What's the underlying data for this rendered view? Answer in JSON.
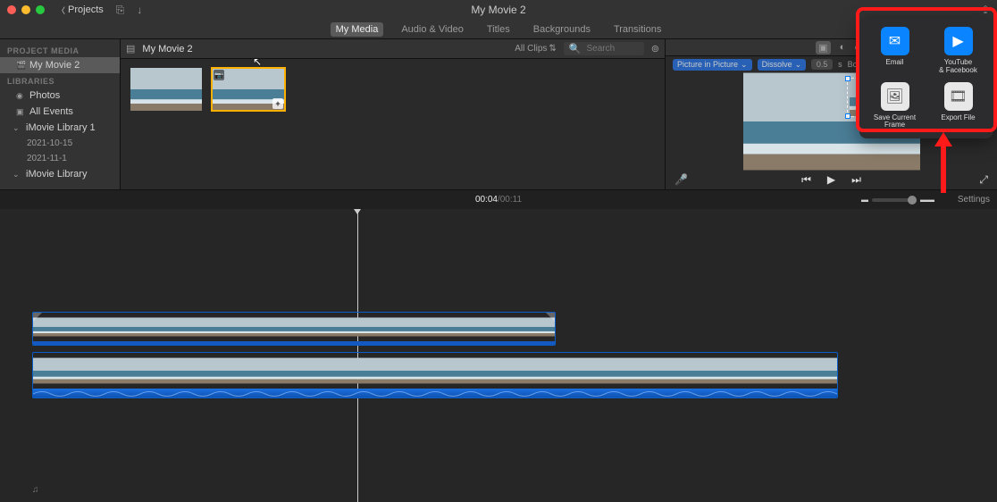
{
  "titlebar": {
    "back_label": "Projects",
    "title": "My Movie 2"
  },
  "tabs": [
    "My Media",
    "Audio & Video",
    "Titles",
    "Backgrounds",
    "Transitions"
  ],
  "tabs_selected": 0,
  "sidebar": {
    "section1": "PROJECT MEDIA",
    "project": "My Movie 2",
    "section2": "LIBRARIES",
    "items": [
      {
        "label": "Photos",
        "icon": "◉"
      },
      {
        "label": "All Events",
        "icon": "▣"
      },
      {
        "label": "iMovie Library 1",
        "icon": "▸",
        "expandable": true,
        "children": [
          "2021-10-15",
          "2021-11-1"
        ]
      },
      {
        "label": "iMovie Library",
        "icon": "▸",
        "expandable": true
      }
    ]
  },
  "browser": {
    "title": "My Movie 2",
    "filter": "All Clips",
    "search_placeholder": "Search"
  },
  "viewer": {
    "mode": "Picture in Picture",
    "transition": "Dissolve",
    "duration": "0.5",
    "duration_unit": "s",
    "border_label": "Border:"
  },
  "timecode": {
    "current": "00:04",
    "sep": " / ",
    "duration": "00:11"
  },
  "settings_label": "Settings",
  "share": {
    "items": [
      {
        "key": "email",
        "icon": "✉",
        "cls": "ic-blue",
        "label": "Email"
      },
      {
        "key": "yt",
        "icon": "▶",
        "cls": "ic-blue",
        "label": "YouTube\n& Facebook"
      },
      {
        "key": "frame",
        "icon": "🖼",
        "cls": "ic-grey",
        "label": "Save Current Frame"
      },
      {
        "key": "export",
        "icon": "🎞",
        "cls": "ic-grey",
        "label": "Export File"
      }
    ]
  }
}
